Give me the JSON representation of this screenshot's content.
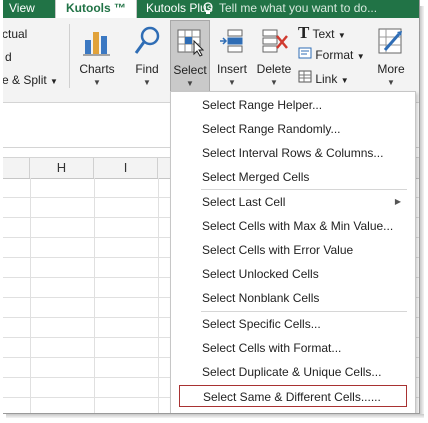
{
  "tabs": [
    {
      "label": "View",
      "active": false
    },
    {
      "label": "Kutools ™",
      "active": true
    },
    {
      "label": "Kutools Plus",
      "active": false
    }
  ],
  "tell_me": "Tell me what you want to do...",
  "ribbon": {
    "left_fragments": [
      "ctual",
      "d",
      "e & Split"
    ],
    "buttons": [
      "Charts",
      "Find",
      "Select",
      "Insert",
      "Delete",
      "More"
    ],
    "text_group": [
      "Text",
      "Format",
      "Link"
    ]
  },
  "columns": [
    "H",
    "I"
  ],
  "menu": {
    "items": [
      "Select Range Helper...",
      "Select Range Randomly...",
      "Select Interval Rows & Columns...",
      "Select Merged Cells",
      "Select Last Cell",
      "Select Cells with Max & Min Value...",
      "Select Cells with Error Value",
      "Select Unlocked Cells",
      "Select Nonblank Cells",
      "Select Specific Cells...",
      "Select Cells with Format...",
      "Select Duplicate & Unique Cells...",
      "Select Same & Different Cells......"
    ],
    "highlighted_index": 12
  },
  "colors": {
    "ribbon_green": "#217346",
    "highlight_border": "#a83232"
  }
}
